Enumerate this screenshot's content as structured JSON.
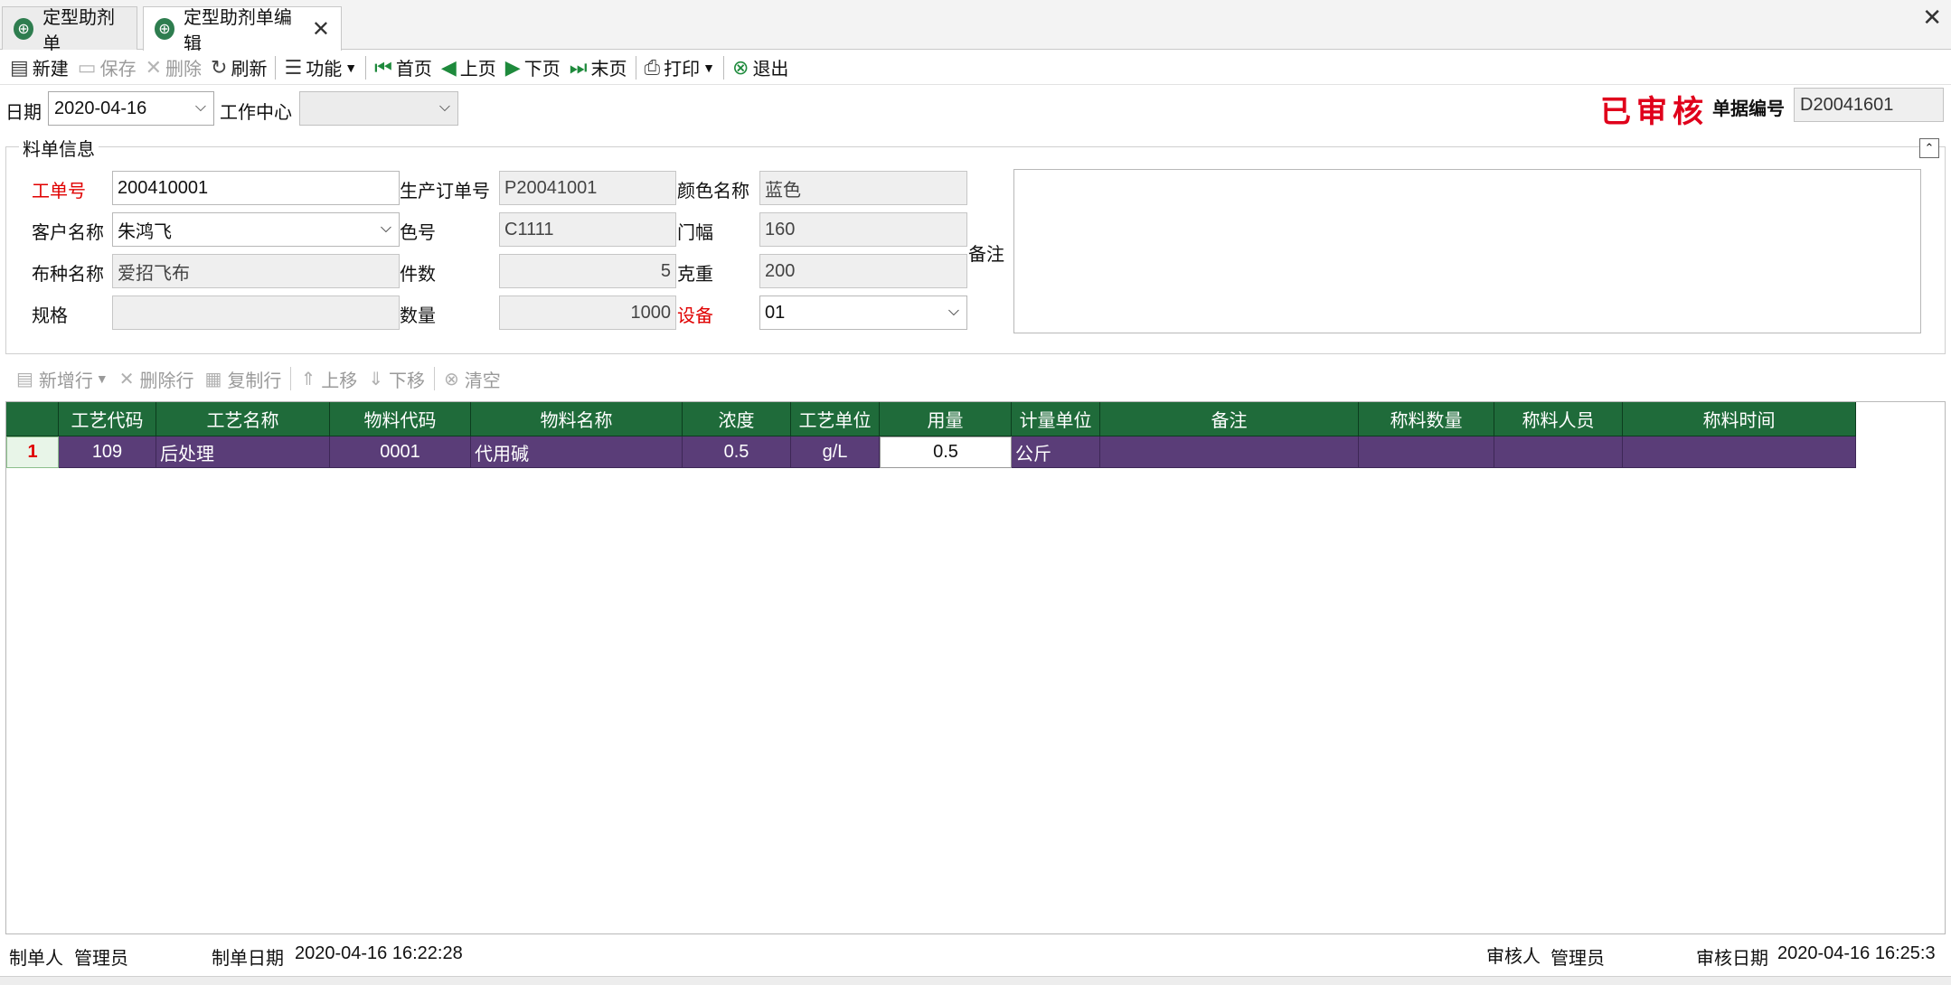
{
  "tabs": [
    {
      "label": "定型助剂单",
      "icon": "globe-icon"
    },
    {
      "label": "定型助剂单编辑",
      "icon": "globe-icon",
      "close": "✕"
    }
  ],
  "window_close": "✕",
  "toolbar": {
    "new": "新建",
    "save": "保存",
    "delete": "删除",
    "refresh": "刷新",
    "function": "功能",
    "first": "首页",
    "prev": "上页",
    "next": "下页",
    "last": "末页",
    "print": "打印",
    "exit": "退出"
  },
  "header": {
    "date_label": "日期",
    "date_value": "2020-04-16",
    "work_center_label": "工作中心",
    "work_center_value": "",
    "status_stamp": "已审核",
    "doc_no_label": "单据编号",
    "doc_no_value": "D20041601"
  },
  "group": {
    "title": "料单信息",
    "work_order_label": "工单号",
    "work_order_value": "200410001",
    "prod_order_label": "生产订单号",
    "prod_order_value": "P20041001",
    "color_name_label": "颜色名称",
    "color_name_value": "蓝色",
    "customer_label": "客户名称",
    "customer_value": "朱鸿飞",
    "color_no_label": "色号",
    "color_no_value": "C1111",
    "width_label": "门幅",
    "width_value": "160",
    "fabric_label": "布种名称",
    "fabric_value": "爱招飞布",
    "pieces_label": "件数",
    "pieces_value": "5",
    "weight_label": "克重",
    "weight_value": "200",
    "spec_label": "规格",
    "spec_value": "",
    "qty_label": "数量",
    "qty_value": "1000",
    "device_label": "设备",
    "device_value": "01",
    "remark_label": "备注",
    "remark_value": ""
  },
  "grid_toolbar": {
    "add_row": "新增行",
    "delete_row": "删除行",
    "copy_row": "复制行",
    "move_up": "上移",
    "move_down": "下移",
    "clear": "清空"
  },
  "grid": {
    "columns": [
      "工艺代码",
      "工艺名称",
      "物料代码",
      "物料名称",
      "浓度",
      "工艺单位",
      "用量",
      "计量单位",
      "备注",
      "称料数量",
      "称料人员",
      "称料时间"
    ],
    "rows": [
      {
        "num": "1",
        "cells": [
          "109",
          "后处理",
          "0001",
          "代用碱",
          "0.5",
          "g/L",
          "0.5",
          "公斤",
          "",
          "",
          "",
          ""
        ]
      }
    ]
  },
  "footer": {
    "maker_label": "制单人",
    "maker_value": "管理员",
    "make_date_label": "制单日期",
    "make_date_value": "2020-04-16 16:22:28",
    "auditor_label": "审核人",
    "auditor_value": "管理员",
    "audit_date_label": "审核日期",
    "audit_date_value": "2020-04-16 16:25:3"
  }
}
